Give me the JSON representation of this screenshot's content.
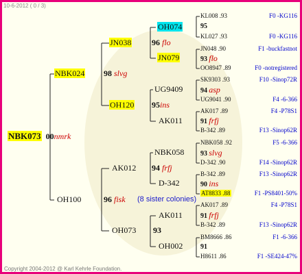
{
  "header": "10-6-2012 ( 0 / 3)",
  "copyright": "Copyright 2004-2012 @ Karl Kehrle Foundation.",
  "root": {
    "id": "NBK073",
    "gen": "00",
    "name": "nmrk"
  },
  "g1": [
    {
      "id": "NBK024",
      "gen": "98",
      "name": "slvg"
    },
    {
      "id": "OH100",
      "gen": "96",
      "name": "fisk",
      "note": "(8 sister colonies)"
    }
  ],
  "g2": [
    {
      "id": "JN038",
      "gen": "96",
      "name": "flo"
    },
    {
      "id": "OH120",
      "gen": "95",
      "name": "ins"
    },
    {
      "id": "AK012",
      "gen": "94",
      "name": "frfj"
    },
    {
      "id": "OH073",
      "gen": "93",
      "name": ""
    }
  ],
  "g3": [
    {
      "id": "OH074"
    },
    {
      "id": "JN079"
    },
    {
      "id": "UG9409"
    },
    {
      "id": "AK011"
    },
    {
      "id": "NBK058"
    },
    {
      "id": "D-342"
    },
    {
      "id": "AK011"
    },
    {
      "id": "OH002"
    }
  ],
  "g4": [
    {
      "l1": "KL008 .93",
      "gen": "95",
      "name": "",
      "l3": "KL027 .93",
      "i1": "F0 -KG116",
      "i3": "F0 -KG116"
    },
    {
      "l1": "JN048 .90",
      "gen": "93",
      "name": "flo",
      "l3": "OO8947 .89",
      "i1": "F1 -buckfastnot",
      "i3": "F0 -notregistered"
    },
    {
      "l1": "SK9303 .93",
      "gen": "94",
      "name": "asp",
      "l3": "UG9041 .90",
      "i1": "F10 -Sinop72R",
      "i3": "F4 -6-366"
    },
    {
      "l1": "AK017 .89",
      "gen": "91",
      "name": "frfj",
      "l3": "B-342 .89",
      "i1": "F4 -P78S1",
      "i3": "F13 -Sinop62R"
    },
    {
      "l1": "NBK058 .92",
      "gen": "93",
      "name": "slvg",
      "l3": "D-342 .90",
      "i1": "F5 -6-366",
      "i3": "F14 -Sinop62R"
    },
    {
      "l1": "B-342 .89",
      "gen": "90",
      "name": "ins",
      "l3": "AT8833 .88",
      "i1": "F13 -Sinop62R",
      "i3": "F1 -PS8401-50%"
    },
    {
      "l1": "AK017 .89",
      "gen": "91",
      "name": "frfj",
      "l3": "B-342 .89",
      "i1": "F4 -P78S1",
      "i3": "F13 -Sinop62R"
    },
    {
      "l1": "BM8666 .86",
      "gen": "91",
      "name": "",
      "l3": "H8611 .86",
      "i1": "F1 -6-366",
      "i3": "F1 -SE424-47%"
    }
  ]
}
